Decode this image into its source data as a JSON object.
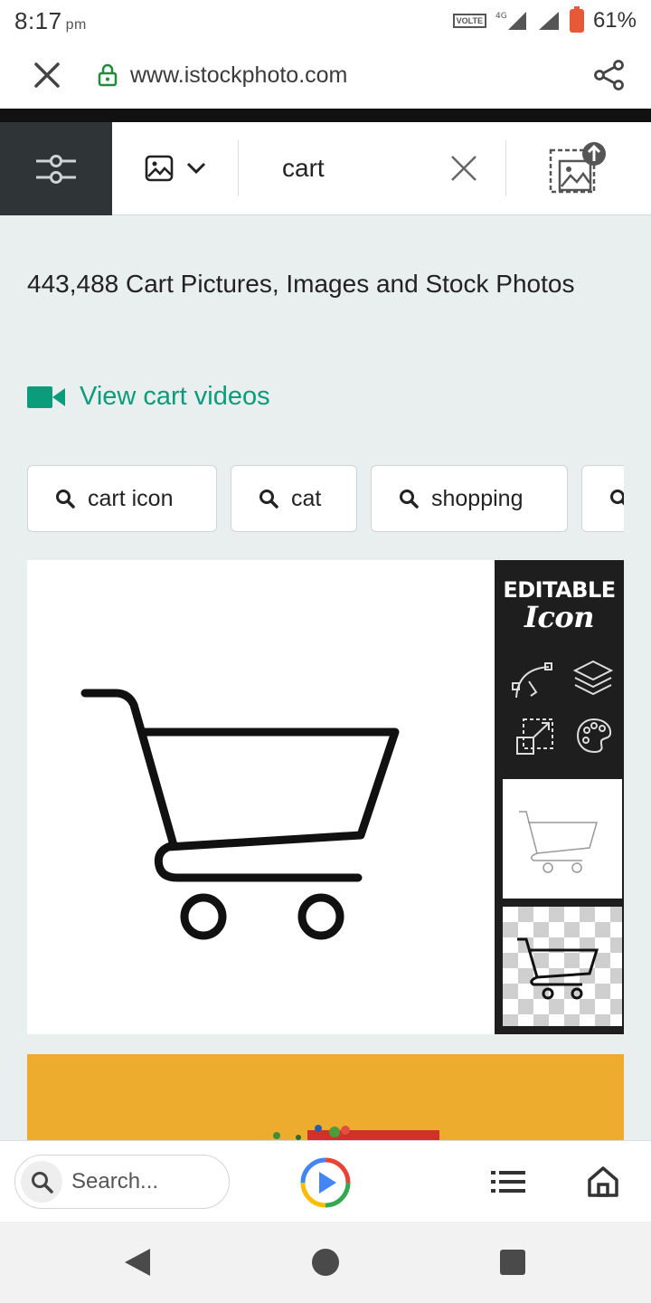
{
  "status_bar": {
    "time": "8:17",
    "ampm": "pm",
    "volte": "VOLTE",
    "network": "4G",
    "battery": "61%"
  },
  "browser": {
    "url": "www.istockphoto.com"
  },
  "search_toolbar": {
    "query": "cart"
  },
  "results": {
    "title": "443,488 Cart Pictures, Images and Stock Photos",
    "videos_link": "View cart videos"
  },
  "chips": [
    {
      "label": "cart icon"
    },
    {
      "label": "cat"
    },
    {
      "label": "shopping"
    }
  ],
  "image_card": {
    "badge_line1": "EDITABLE",
    "badge_line2": "Icon"
  },
  "bottom_bar": {
    "search_placeholder": "Search..."
  },
  "colors": {
    "accent_green": "#0b9c7c",
    "filter_bg": "#2f3436",
    "page_bg": "#e9eeee"
  }
}
